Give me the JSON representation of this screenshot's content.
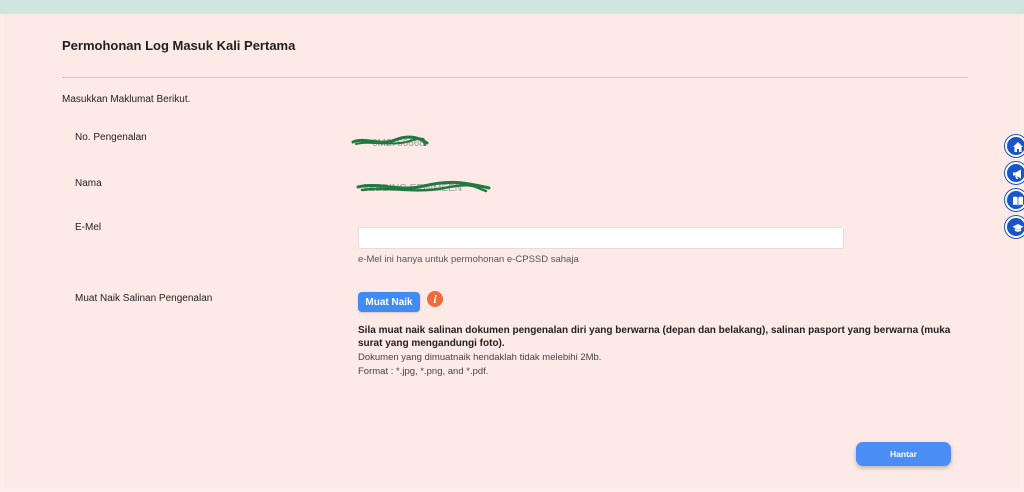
{
  "form": {
    "title": "Permohonan Log Masuk Kali Pertama",
    "intro": "Masukkan Maklumat Berikut.",
    "fields": {
      "id_label": "No. Pengenalan",
      "id_value": "0M2766668",
      "name_label": "Nama",
      "name_value": "SEEDING EENIMEEN",
      "email_label": "E-Mel",
      "email_value": "",
      "email_help": "e-Mel ini hanya untuk permohonan e-CPSSD sahaja",
      "upload_label": "Muat Naik Salinan Pengenalan"
    },
    "upload_button": "Muat Naik",
    "upload_note_bold": "Sila muat naik salinan dokumen pengenalan diri yang berwarna (depan dan belakang), salinan pasport yang berwarna (muka surat yang mengandungi foto).",
    "upload_note_size": "Dokumen yang dimuatnaik hendaklah tidak melebihi 2Mb.",
    "upload_note_format": "Format : *.jpg, *.png, and *.pdf.",
    "submit_button": "Hantar"
  },
  "side_nav": {
    "icons": [
      "home-icon",
      "megaphone-icon",
      "book-icon",
      "graduation-cap-icon"
    ]
  },
  "colors": {
    "background": "#fde9e5",
    "top_bar": "#cfe6df",
    "primary_button": "#4a8ef5",
    "info_icon": "#f06a3a",
    "side_nav": "#1a56c9",
    "redaction": "#1f7a3f"
  }
}
